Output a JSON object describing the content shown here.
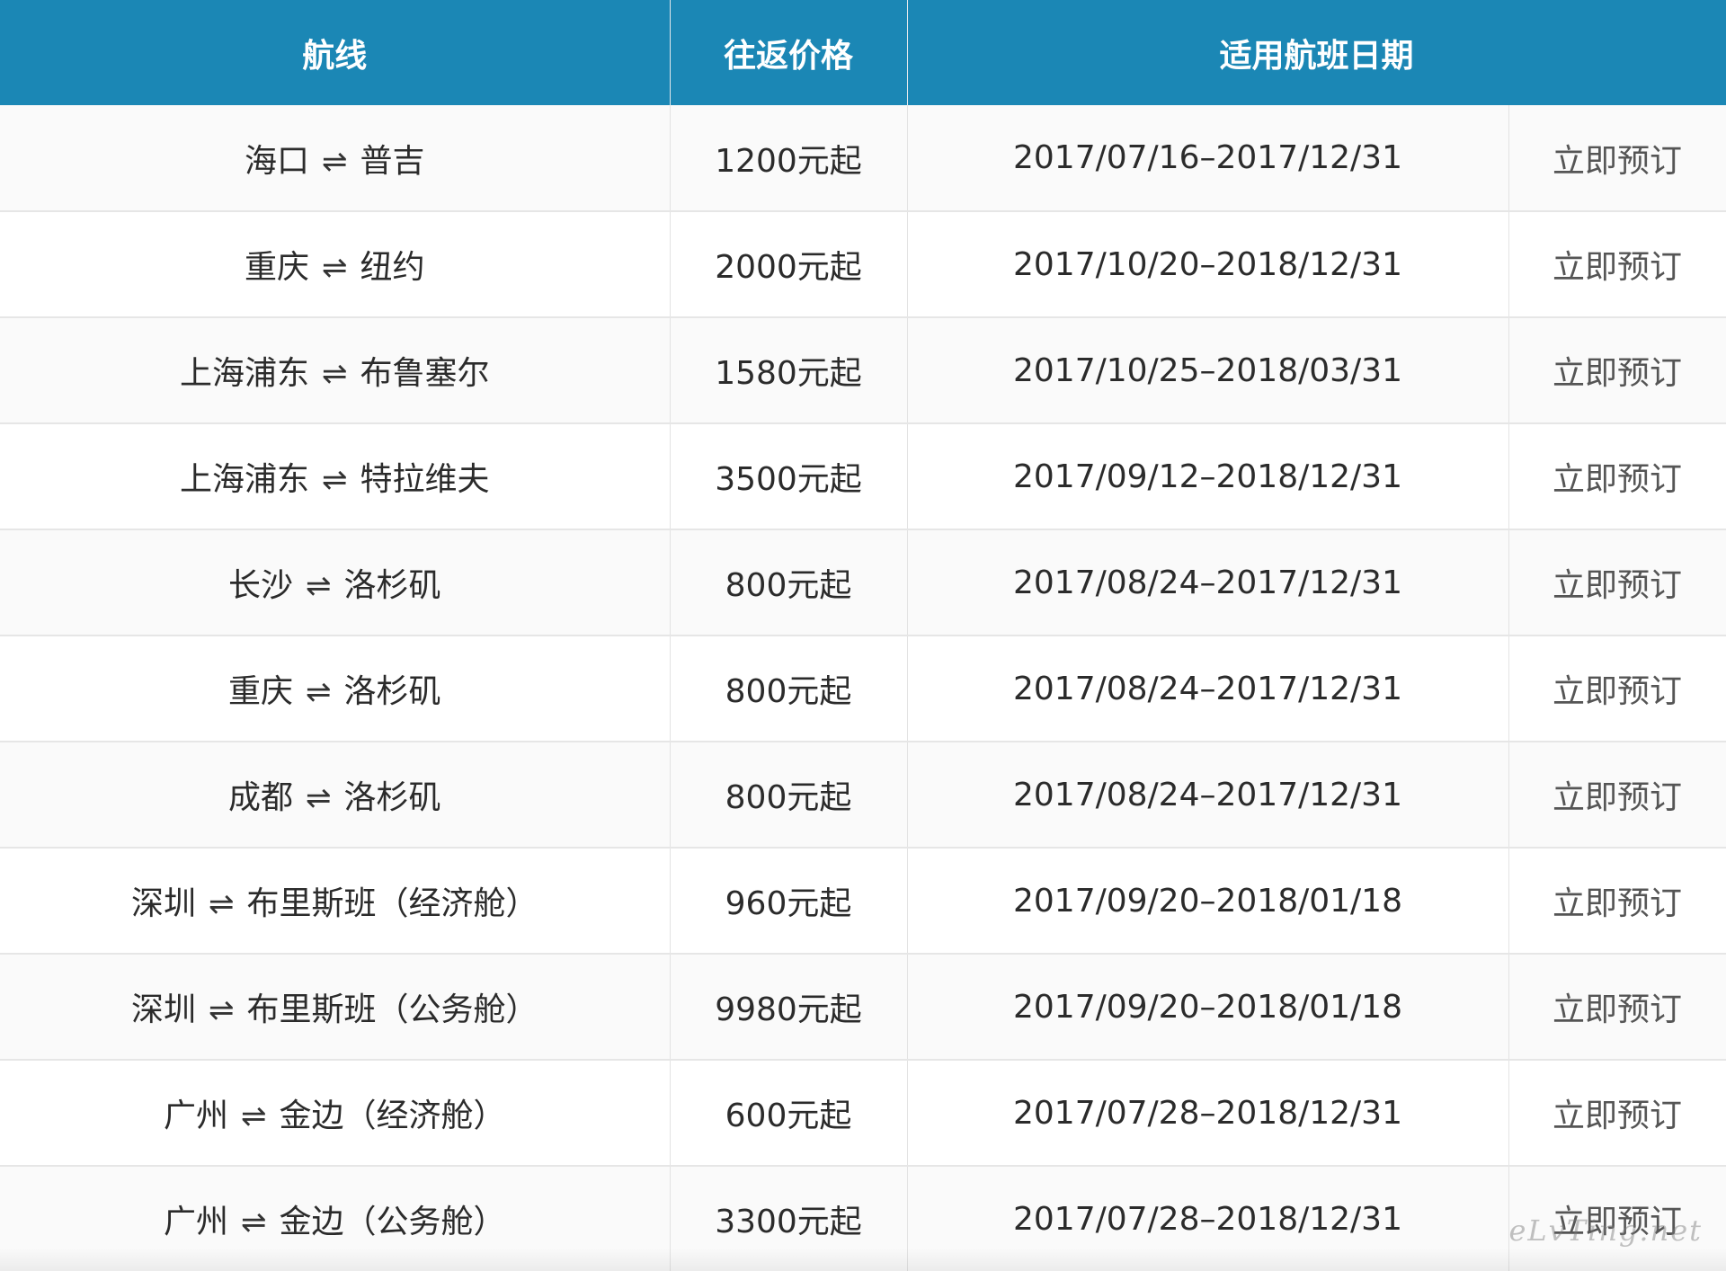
{
  "table": {
    "headers": {
      "route": "航线",
      "price": "往返价格",
      "dates": "适用航班日期"
    },
    "arrow_icon": "⇌",
    "rows": [
      {
        "from": "海口",
        "to": "普吉",
        "price": "1200元起",
        "dates": "2017/07/16–2017/12/31",
        "action": "立即预订"
      },
      {
        "from": "重庆",
        "to": "纽约",
        "price": "2000元起",
        "dates": "2017/10/20–2018/12/31",
        "action": "立即预订"
      },
      {
        "from": "上海浦东",
        "to": "布鲁塞尔",
        "price": "1580元起",
        "dates": "2017/10/25–2018/03/31",
        "action": "立即预订"
      },
      {
        "from": "上海浦东",
        "to": "特拉维夫",
        "price": "3500元起",
        "dates": "2017/09/12–2018/12/31",
        "action": "立即预订"
      },
      {
        "from": "长沙",
        "to": "洛杉矶",
        "price": "800元起",
        "dates": "2017/08/24–2017/12/31",
        "action": "立即预订"
      },
      {
        "from": "重庆",
        "to": "洛杉矶",
        "price": "800元起",
        "dates": "2017/08/24–2017/12/31",
        "action": "立即预订"
      },
      {
        "from": "成都",
        "to": "洛杉矶",
        "price": "800元起",
        "dates": "2017/08/24–2017/12/31",
        "action": "立即预订"
      },
      {
        "from": "深圳",
        "to": "布里斯班（经济舱）",
        "price": "960元起",
        "dates": "2017/09/20–2018/01/18",
        "action": "立即预订"
      },
      {
        "from": "深圳",
        "to": "布里斯班（公务舱）",
        "price": "9980元起",
        "dates": "2017/09/20–2018/01/18",
        "action": "立即预订"
      },
      {
        "from": "广州",
        "to": "金边（经济舱）",
        "price": "600元起",
        "dates": "2017/07/28–2018/12/31",
        "action": "立即预订"
      },
      {
        "from": "广州",
        "to": "金边（公务舱）",
        "price": "3300元起",
        "dates": "2017/07/28–2018/12/31",
        "action": "立即预订"
      }
    ]
  },
  "watermark": "eLvTing.net",
  "colors": {
    "header_bg": "#1b87b5",
    "header_text": "#ffffff",
    "row_alt": "#fafafa",
    "border": "#e3e3e3"
  }
}
